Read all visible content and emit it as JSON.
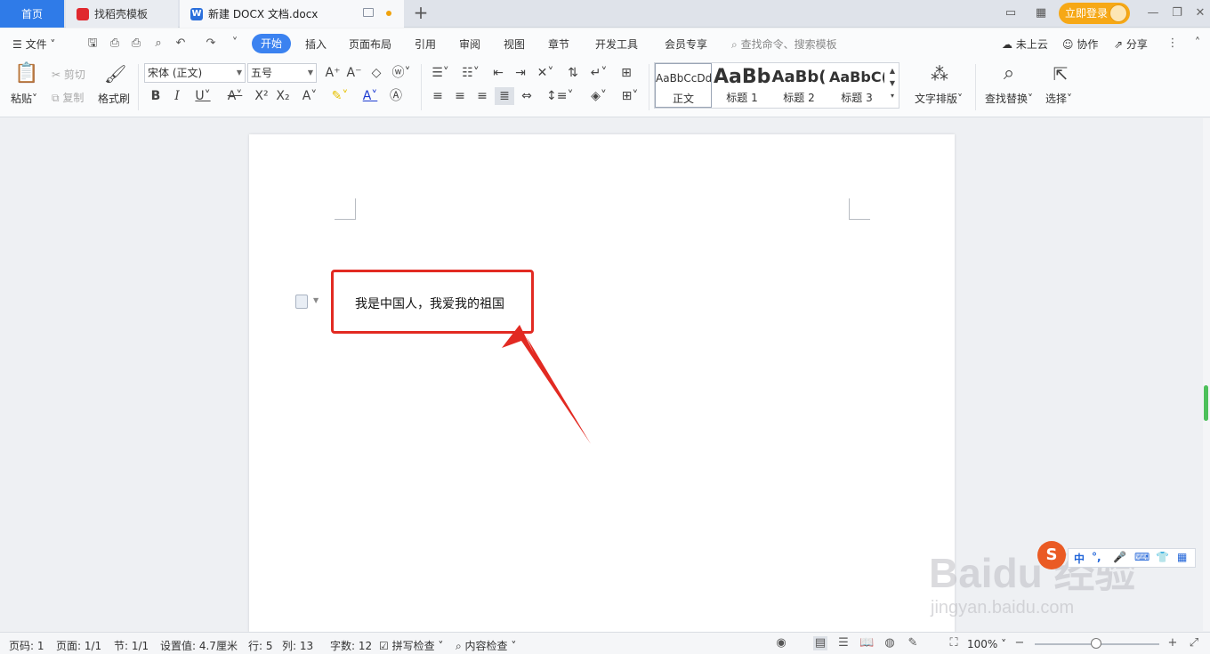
{
  "tabs": {
    "home": "首页",
    "templates": "找稻壳模板",
    "document": "新建 DOCX 文档.docx",
    "add": "+"
  },
  "account": {
    "login_label": "立即登录"
  },
  "menu": {
    "file": "文件",
    "items": [
      "开始",
      "插入",
      "页面布局",
      "引用",
      "审阅",
      "视图",
      "章节",
      "开发工具",
      "会员专享"
    ],
    "search_placeholder": "查找命令、搜索模板",
    "cloud": "未上云",
    "collab": "协作",
    "share": "分享"
  },
  "ribbon": {
    "paste": "粘贴",
    "cut": "剪切",
    "copy": "复制",
    "format_painter": "格式刷",
    "font_name": "宋体 (正文)",
    "font_size": "五号",
    "styles": [
      {
        "sample": "AaBbCcDd",
        "name": "正文"
      },
      {
        "sample": "AaBb",
        "name": "标题 1"
      },
      {
        "sample": "AaBb(",
        "name": "标题 2"
      },
      {
        "sample": "AaBbC(",
        "name": "标题 3"
      }
    ],
    "text_layout": "文字排版",
    "find_replace": "查找替换",
    "select": "选择"
  },
  "document": {
    "text": "我是中国人，我爱我的祖国"
  },
  "ime": [
    "中",
    "°,",
    "🎤",
    "⌨",
    "👕",
    "▦"
  ],
  "watermark": {
    "main": "Baidu 经验",
    "sub": "jingyan.baidu.com"
  },
  "status": {
    "page_no": "页码: 1",
    "pages": "页面: 1/1",
    "section": "节: 1/1",
    "setting": "设置值: 4.7厘米",
    "row": "行: 5",
    "col": "列: 13",
    "word_count": "字数: 12",
    "spell_check": "拼写检查",
    "content_check": "内容检查",
    "zoom": "100%"
  },
  "colors": {
    "accent": "#3b82f0",
    "highlight_red": "#e22a22",
    "login_orange": "#f6a816"
  }
}
